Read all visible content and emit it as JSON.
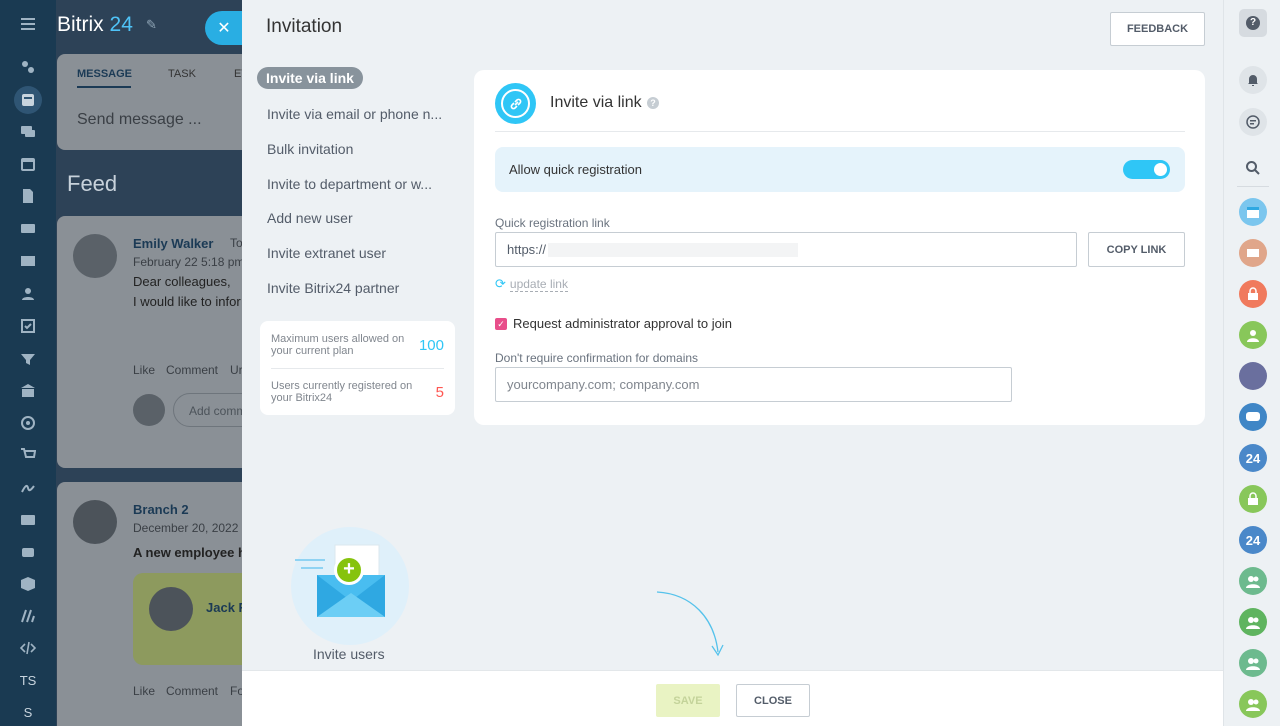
{
  "portal": {
    "brand": "Bitrix",
    "brand_number": "24"
  },
  "background": {
    "composer_tabs": [
      "MESSAGE",
      "TASK",
      "EV"
    ],
    "composer_placeholder": "Send message ...",
    "feed_title": "Feed",
    "post1": {
      "author": "Emily Walker",
      "to": "To",
      "date": "February 22 5:18 pm",
      "line1": "Dear colleagues,",
      "line2": "I would like to infor",
      "actions": [
        "Like",
        "Comment",
        "Ur"
      ],
      "comment_placeholder": "Add comm"
    },
    "post2": {
      "author": "Branch 2",
      "date": "December 20, 2022",
      "text": "A new employee h",
      "card_name": "Jack F",
      "actions": [
        "Like",
        "Comment",
        "Fo"
      ]
    }
  },
  "leftnav": {
    "initials": [
      "TS",
      "S"
    ]
  },
  "slider": {
    "title": "Invitation",
    "feedback_label": "FEEDBACK",
    "menu": [
      {
        "label": "Invite via link",
        "active": true
      },
      {
        "label": "Invite via email or phone n..."
      },
      {
        "label": "Bulk invitation"
      },
      {
        "label": "Invite to department or w..."
      },
      {
        "label": "Add new user"
      },
      {
        "label": "Invite extranet user"
      },
      {
        "label": "Invite Bitrix24 partner"
      }
    ],
    "limits": [
      {
        "label": "Maximum users allowed on your current plan",
        "value": "100",
        "color": "#2fc6f6"
      },
      {
        "label": "Users currently registered on your Bitrix24",
        "value": "5",
        "color": "#ff5752"
      }
    ],
    "panel": {
      "title": "Invite via link",
      "quick_reg_label": "Allow quick registration",
      "quick_reg_enabled": true,
      "link_label": "Quick registration link",
      "link_value": "https://",
      "copy_label": "COPY LINK",
      "update_label": "update link",
      "approval_label": "Request administrator approval to join",
      "approval_checked": true,
      "domains_label": "Don't require confirmation for domains",
      "domains_placeholder": "yourcompany.com; company.com"
    },
    "promo_label": "Invite users",
    "save_label": "SAVE",
    "close_label": "CLOSE"
  },
  "rightbar": {
    "avatars": [
      "24",
      "24"
    ]
  },
  "colors": {
    "accent": "#2fc6f6",
    "save_disabled": "#e9f3c3",
    "active_toggle": "#2fc6f6",
    "checkbox": "#e84e8a"
  }
}
